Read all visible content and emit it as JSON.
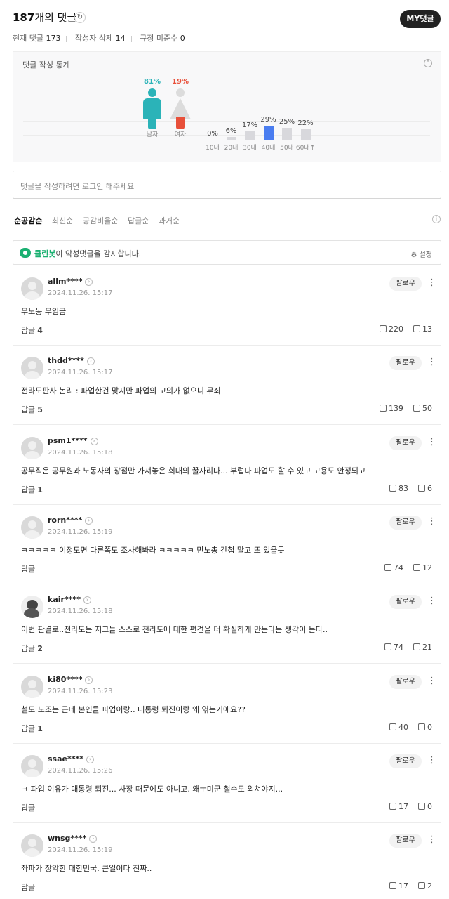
{
  "header": {
    "count": "187",
    "title_suffix": "개의 댓글",
    "refresh_icon": "refresh-icon",
    "my_comments_button": "MY댓글"
  },
  "stats": {
    "current_label": "현재 댓글",
    "current_value": "173",
    "author_deleted_label": "작성자 삭제",
    "author_deleted_value": "14",
    "violation_label": "규정 미준수",
    "violation_value": "0"
  },
  "stats_box": {
    "title": "댓글 작성 통계",
    "male": {
      "pct": "81%",
      "label": "남자",
      "value": 81,
      "color": "#2bb3b8"
    },
    "female": {
      "pct": "19%",
      "label": "여자",
      "value": 19,
      "color": "#e8503a"
    },
    "ages": [
      {
        "label": "10대",
        "pct": "0%",
        "value": 0,
        "highlight": false
      },
      {
        "label": "20대",
        "pct": "6%",
        "value": 6,
        "highlight": false
      },
      {
        "label": "30대",
        "pct": "17%",
        "value": 17,
        "highlight": false
      },
      {
        "label": "40대",
        "pct": "29%",
        "value": 29,
        "highlight": true
      },
      {
        "label": "50대",
        "pct": "25%",
        "value": 25,
        "highlight": false
      },
      {
        "label": "60대↑",
        "pct": "22%",
        "value": 22,
        "highlight": false
      }
    ],
    "highlight_color": "#4a7df0"
  },
  "comment_input": {
    "placeholder": "댓글을 작성하려면 로그인 해주세요"
  },
  "sort_tabs": [
    "순공감순",
    "최신순",
    "공감비율순",
    "답글순",
    "과거순"
  ],
  "cleanbot": {
    "name": "클린봇",
    "message": "이 악성댓글을 감지합니다.",
    "settings_label": "설정"
  },
  "comments": [
    {
      "user": "allm****",
      "date": "2024.11.26. 15:17",
      "text": "무노동 무임금",
      "reply_label": "답글",
      "replies": "4",
      "likes": "220",
      "dislikes": "13",
      "follow": "팔로우",
      "custom_avatar": false
    },
    {
      "user": "thdd****",
      "date": "2024.11.26. 15:17",
      "text": "전라도판사 논리 : 파업한건 맞지만 파업의 고의가 없으니 무죄",
      "reply_label": "답글",
      "replies": "5",
      "likes": "139",
      "dislikes": "50",
      "follow": "팔로우",
      "custom_avatar": false
    },
    {
      "user": "psm1****",
      "date": "2024.11.26. 15:18",
      "text": "공무직은 공무원과 노동자의 장점만 가져놓은 희대의 꿀자리다... 부럽다 파업도 할 수 있고 고용도 안정되고",
      "reply_label": "답글",
      "replies": "1",
      "likes": "83",
      "dislikes": "6",
      "follow": "팔로우",
      "custom_avatar": false
    },
    {
      "user": "rorn****",
      "date": "2024.11.26. 15:19",
      "text": "ㅋㅋㅋㅋㅋ 이정도면 다른쪽도 조사해봐라 ㅋㅋㅋㅋㅋ 민노총 간첩 말고 또 있을듯",
      "reply_label": "답글",
      "replies": "",
      "likes": "74",
      "dislikes": "12",
      "follow": "팔로우",
      "custom_avatar": false
    },
    {
      "user": "kair****",
      "date": "2024.11.26. 15:18",
      "text": "이번 판결로..전라도는 지그들 스스로 전라도애 대한 편견을 더 확실하게 만든다는 생각이 든다..",
      "reply_label": "답글",
      "replies": "2",
      "likes": "74",
      "dislikes": "21",
      "follow": "팔로우",
      "custom_avatar": true
    },
    {
      "user": "ki80****",
      "date": "2024.11.26. 15:23",
      "text": "철도 노조는 근데 본인들 파업이랑.. 대통령 퇴진이랑 왜 엮는거에요??",
      "reply_label": "답글",
      "replies": "1",
      "likes": "40",
      "dislikes": "0",
      "follow": "팔로우",
      "custom_avatar": false
    },
    {
      "user": "ssae****",
      "date": "2024.11.26. 15:26",
      "text": "ㅋ 파업 이유가 대통령 퇴진... 사장 때문에도 아니고. 왜ㅜ미군 철수도 외쳐야지...",
      "reply_label": "답글",
      "replies": "",
      "likes": "17",
      "dislikes": "0",
      "follow": "팔로우",
      "custom_avatar": false
    },
    {
      "user": "wnsg****",
      "date": "2024.11.26. 15:19",
      "text": "좌파가 장악한 대한민국. 큰일이다 진짜..",
      "reply_label": "답글",
      "replies": "",
      "likes": "17",
      "dislikes": "2",
      "follow": "팔로우",
      "custom_avatar": false
    }
  ]
}
